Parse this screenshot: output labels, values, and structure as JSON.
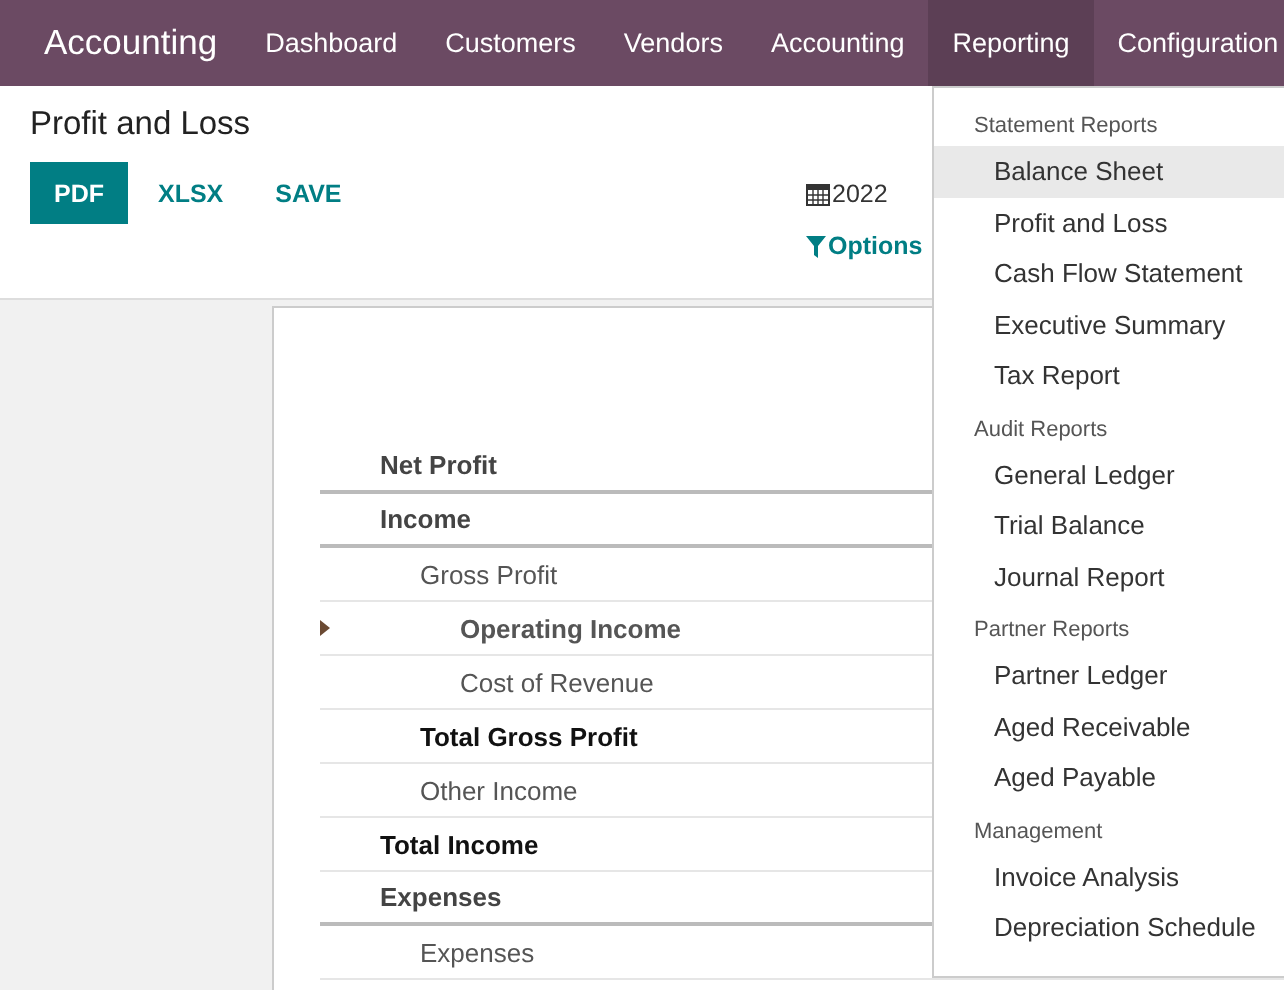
{
  "navbar": {
    "brand": "Accounting",
    "menu": [
      {
        "label": "Dashboard",
        "selected": false
      },
      {
        "label": "Customers",
        "selected": false
      },
      {
        "label": "Vendors",
        "selected": false
      },
      {
        "label": "Accounting",
        "selected": false
      },
      {
        "label": "Reporting",
        "selected": true
      },
      {
        "label": "Configuration",
        "selected": false
      }
    ]
  },
  "control_panel": {
    "title": "Profit and Loss",
    "buttons": [
      {
        "label": "PDF",
        "kind": "primary"
      },
      {
        "label": "XLSX",
        "kind": "link"
      },
      {
        "label": "SAVE",
        "kind": "link"
      }
    ],
    "date_filter": "2022",
    "options": "Options"
  },
  "report": {
    "rows": [
      {
        "label": "Net Profit",
        "kind": "header"
      },
      {
        "label": "Income",
        "kind": "header",
        "children": [
          {
            "label": "Gross Profit",
            "kind": "line",
            "children": [
              {
                "label": "Operating Income",
                "kind": "foldable"
              },
              {
                "label": "Cost of Revenue",
                "kind": "line"
              }
            ]
          },
          {
            "label": "Total Gross Profit",
            "kind": "total"
          },
          {
            "label": "Other Income",
            "kind": "line"
          }
        ]
      },
      {
        "label": "Total Income",
        "kind": "total"
      },
      {
        "label": "Expenses",
        "kind": "header",
        "children": [
          {
            "label": "Expenses",
            "kind": "line"
          }
        ]
      }
    ]
  },
  "dropdown": {
    "sections": [
      {
        "title": "Statement Reports",
        "items": [
          {
            "label": "Balance Sheet",
            "selected": true
          },
          {
            "label": "Profit and Loss",
            "selected": false
          },
          {
            "label": "Cash Flow Statement",
            "selected": false
          },
          {
            "label": "Executive Summary",
            "selected": false
          },
          {
            "label": "Tax Report",
            "selected": false
          }
        ]
      },
      {
        "title": "Audit Reports",
        "items": [
          {
            "label": "General Ledger",
            "selected": false
          },
          {
            "label": "Trial Balance",
            "selected": false
          },
          {
            "label": "Journal Report",
            "selected": false
          }
        ]
      },
      {
        "title": "Partner Reports",
        "items": [
          {
            "label": "Partner Ledger",
            "selected": false
          },
          {
            "label": "Aged Receivable",
            "selected": false
          },
          {
            "label": "Aged Payable",
            "selected": false
          }
        ]
      },
      {
        "title": "Management",
        "items": [
          {
            "label": "Invoice Analysis",
            "selected": false
          },
          {
            "label": "Depreciation Schedule",
            "selected": false
          }
        ]
      }
    ]
  }
}
